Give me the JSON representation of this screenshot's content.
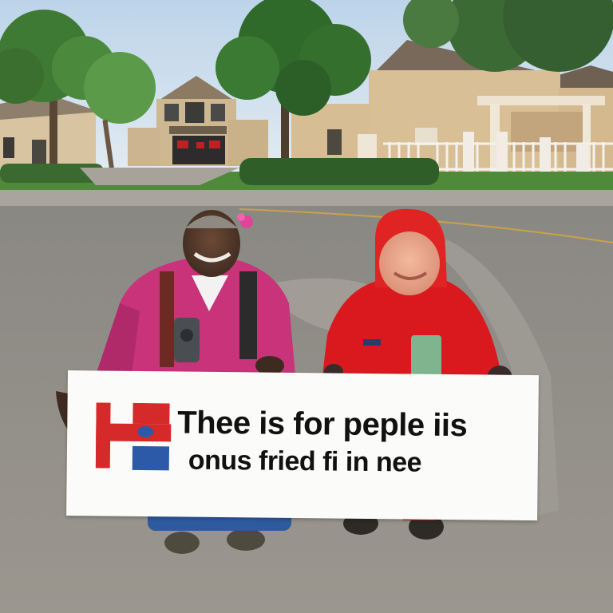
{
  "scene": {
    "description_icons": [
      "house-icon",
      "tree-icon",
      "person-icon",
      "sign-icon"
    ]
  },
  "sign": {
    "line_1": "Thee is  for peple iis",
    "line_2": "onus fried fi in nee",
    "logo_colors": {
      "red": "#d62a2a",
      "blue": "#2c5aa8"
    }
  },
  "colors": {
    "sky": "#cfe0ee",
    "asphalt": "#8f8c86",
    "grass": "#4f8a3a",
    "house_siding": "#d9bf95",
    "left_jacket": "#c8337a",
    "right_jacket": "#d9191e"
  }
}
